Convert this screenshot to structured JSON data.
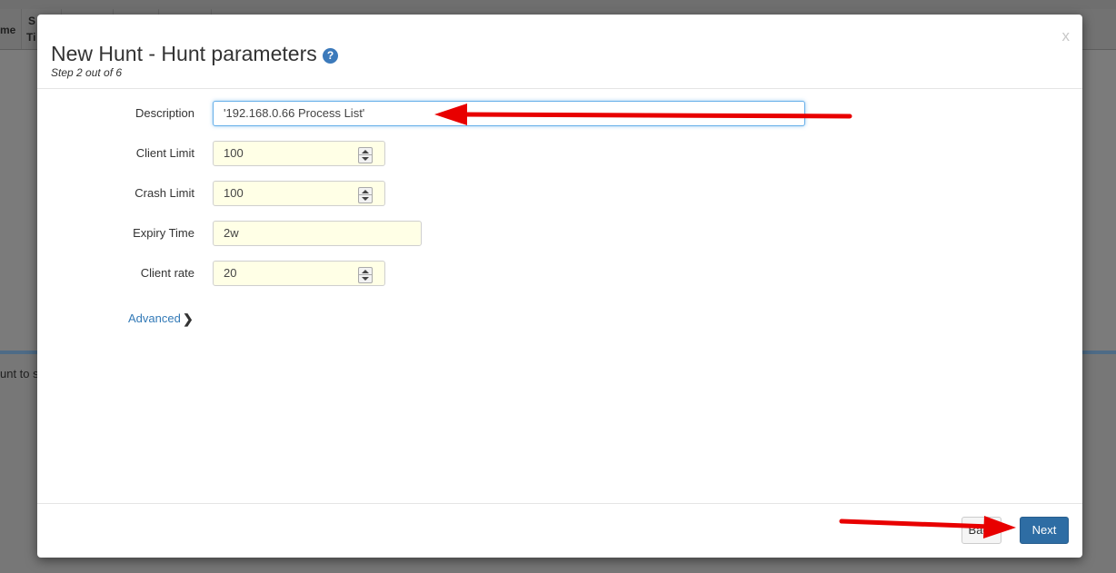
{
  "background": {
    "column_fragment_1": "me",
    "column_fragment_2a": "S",
    "column_fragment_2b": "Ti",
    "lower_text": "unt to s"
  },
  "modal": {
    "title": "New Hunt - Hunt parameters",
    "help_icon_glyph": "?",
    "subtitle": "Step 2 out of 6",
    "close_label": "x"
  },
  "form": {
    "description": {
      "label": "Description",
      "value": "'192.168.0.66 Process List'"
    },
    "client_limit": {
      "label": "Client Limit",
      "value": "100"
    },
    "crash_limit": {
      "label": "Crash Limit",
      "value": "100"
    },
    "expiry_time": {
      "label": "Expiry Time",
      "value": "2w"
    },
    "client_rate": {
      "label": "Client rate",
      "value": "20"
    },
    "advanced_label": "Advanced",
    "advanced_chevron": "❯"
  },
  "footer": {
    "back_label": "Back",
    "next_label": "Next"
  },
  "colors": {
    "annotation_arrow": "#e80000",
    "primary_button": "#2e6da4",
    "field_background": "#ffffe6"
  }
}
